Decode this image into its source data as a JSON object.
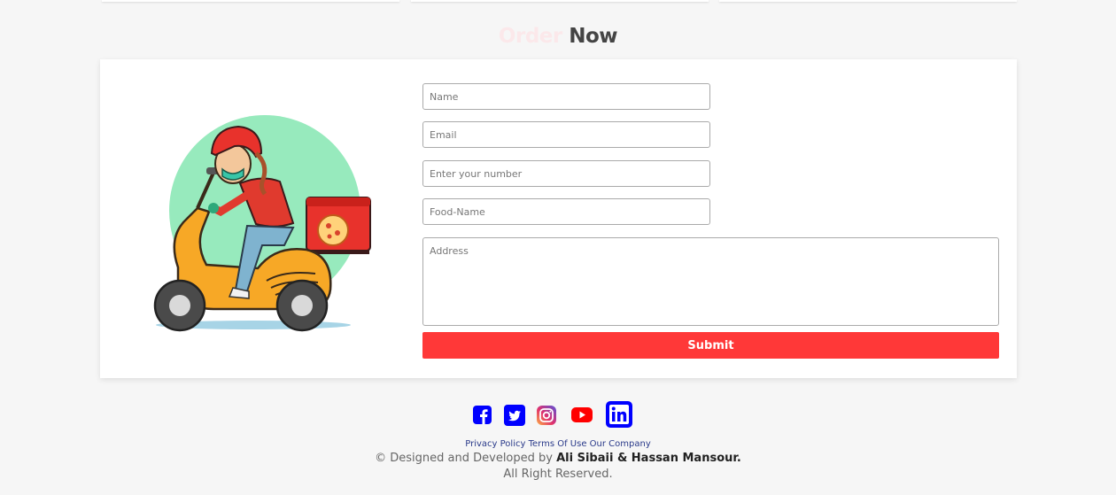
{
  "heading": {
    "word1": "Order",
    "word2": "Now"
  },
  "form": {
    "name_placeholder": "Name",
    "email_placeholder": "Email",
    "number_placeholder": "Enter your number",
    "food_placeholder": "Food-Name",
    "address_placeholder": "Address",
    "submit_label": "Submit"
  },
  "social": {
    "icons": [
      "facebook-icon",
      "twitter-icon",
      "instagram-icon",
      "youtube-icon",
      "linkedin-icon"
    ]
  },
  "footer": {
    "links": [
      "Privacy Policy",
      "Terms Of Use",
      "Our Company"
    ],
    "credit_prefix": "© Designed and Developed by",
    "credit_names": "Ali Sibaii & Hassan Mansour.",
    "rights": "All Right Reserved."
  },
  "colors": {
    "accent": "#ff3838",
    "background": "#f6f6f6",
    "facebook": "#0000ff",
    "twitter": "#0000ff",
    "youtube": "#ff0000",
    "linkedin": "#0000ff"
  }
}
